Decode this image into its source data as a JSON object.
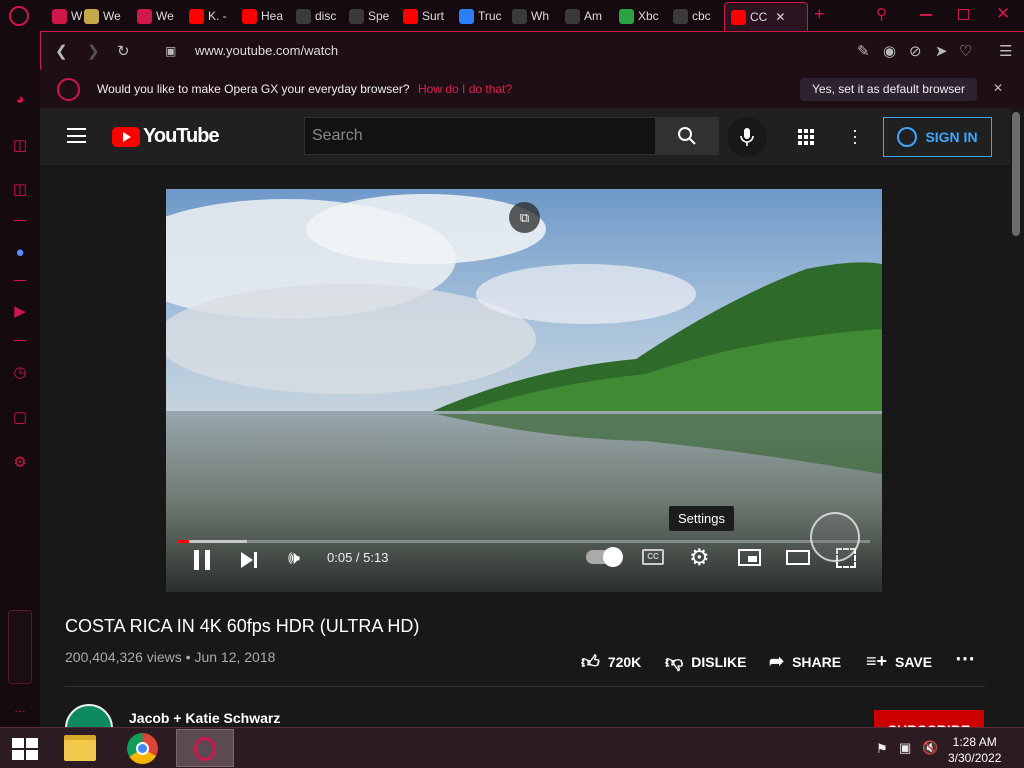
{
  "browser": {
    "tabs": [
      {
        "label": "We",
        "icon": "game-controller-icon",
        "color": "#d1164a"
      },
      {
        "label": "We",
        "icon": "bird-icon",
        "color": "#c4a94a"
      },
      {
        "label": "We",
        "icon": "opera-icon",
        "color": "#d1164a"
      },
      {
        "label": "K. -",
        "icon": "youtube-icon",
        "color": "#ff0000"
      },
      {
        "label": "Hea",
        "icon": "youtube-icon",
        "color": "#ff0000"
      },
      {
        "label": "disc",
        "icon": "globe-icon",
        "color": "#eeeeee"
      },
      {
        "label": "Spe",
        "icon": "grid-icon",
        "color": "#eeeeee"
      },
      {
        "label": "Surt",
        "icon": "youtube-icon",
        "color": "#ff0000"
      },
      {
        "label": "Truc",
        "icon": "bing-icon",
        "color": "#2d7ff9"
      },
      {
        "label": "Wh",
        "icon": "number-2-icon",
        "color": "#ffffff"
      },
      {
        "label": "Am",
        "icon": "amazon-icon",
        "color": "#ffffff"
      },
      {
        "label": "Xbc",
        "icon": "xbox-icon",
        "color": "#2ca243"
      },
      {
        "label": "cbc",
        "icon": "google-icon",
        "color": "#ffffff"
      },
      {
        "label": "CC",
        "icon": "youtube-icon",
        "color": "#ff0000"
      }
    ],
    "url": "www.youtube.com/watch",
    "banner_question": "Would you like to make Opera GX your everyday browser?",
    "banner_link": "How do I do that?",
    "banner_button": "Yes, set it as default browser",
    "accent": "#d1164a"
  },
  "youtube": {
    "logo_text": "YouTube",
    "search_placeholder": "Search",
    "sign_in": "SIGN IN",
    "player": {
      "time": "0:05 / 5:13",
      "tooltip": "Settings",
      "progress": 0.016,
      "buffered": 0.1
    },
    "video_title": "COSTA RICA IN 4K 60fps HDR (ULTRA HD)",
    "views": "200,404,326 views",
    "date": "Jun 12, 2018",
    "likes": "720K",
    "dislike": "DISLIKE",
    "share": "SHARE",
    "save": "SAVE",
    "channel": "Jacob + Katie Schwarz",
    "subscribe": "SUBSCRIBE"
  },
  "taskbar": {
    "time": "1:28 AM",
    "date": "3/30/2022"
  }
}
